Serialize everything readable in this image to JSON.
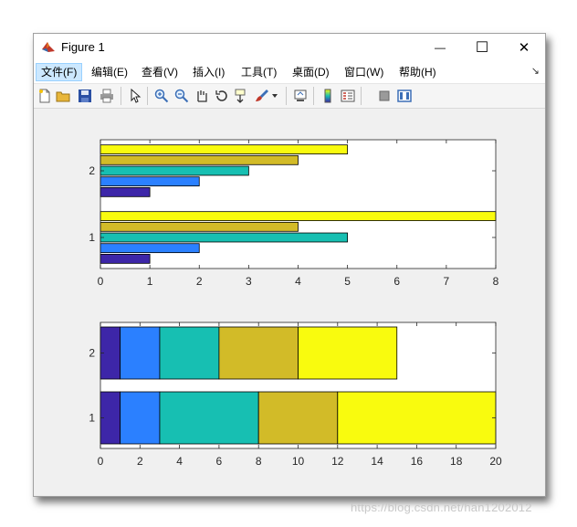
{
  "window": {
    "title": "Figure 1",
    "minimize_glyph": "—",
    "maximize_glyph": "☐",
    "close_glyph": "✕"
  },
  "menu": {
    "items": [
      {
        "label": "文件(F)",
        "active": true
      },
      {
        "label": "编辑(E)"
      },
      {
        "label": "查看(V)"
      },
      {
        "label": "插入(I)"
      },
      {
        "label": "工具(T)"
      },
      {
        "label": "桌面(D)"
      },
      {
        "label": "窗口(W)"
      },
      {
        "label": "帮助(H)"
      }
    ],
    "overflow_glyph": "↘"
  },
  "toolbar": {
    "icons": [
      "new-figure-icon",
      "open-file-icon",
      "save-icon",
      "print-icon",
      "edit-plot-arrow-icon",
      "zoom-in-icon",
      "zoom-out-icon",
      "pan-hand-icon",
      "rotate-3d-icon",
      "data-cursor-icon",
      "brush-icon",
      "brush-dropdown-icon",
      "link-plot-icon",
      "insert-colorbar-icon",
      "insert-legend-icon",
      "hide-plot-tools-icon",
      "show-plot-tools-icon"
    ]
  },
  "colors": {
    "series": [
      "#3d26a8",
      "#2b80ff",
      "#17bfb2",
      "#d2bb28",
      "#f9fb0e"
    ],
    "window_bg": "#f0f0f0",
    "axes_bg": "#ffffff"
  },
  "watermark": "https://blog.csdn.net/han1202012",
  "chart_data": [
    {
      "type": "bar",
      "orientation": "horizontal",
      "mode": "grouped",
      "categories": [
        "1",
        "2"
      ],
      "series": [
        {
          "values": [
            1,
            1
          ]
        },
        {
          "values": [
            2,
            2
          ]
        },
        {
          "values": [
            5,
            3
          ]
        },
        {
          "values": [
            4,
            4
          ]
        },
        {
          "values": [
            8,
            5
          ]
        }
      ],
      "xlim": [
        0,
        8
      ],
      "xticks": [
        0,
        1,
        2,
        3,
        4,
        5,
        6,
        7,
        8
      ],
      "grid": false,
      "legend": false
    },
    {
      "type": "bar",
      "orientation": "horizontal",
      "mode": "stacked",
      "categories": [
        "1",
        "2"
      ],
      "series": [
        {
          "values": [
            1,
            1
          ]
        },
        {
          "values": [
            2,
            2
          ]
        },
        {
          "values": [
            5,
            3
          ]
        },
        {
          "values": [
            4,
            4
          ]
        },
        {
          "values": [
            8,
            5
          ]
        }
      ],
      "xlim": [
        0,
        20
      ],
      "xticks": [
        0,
        2,
        4,
        6,
        8,
        10,
        12,
        14,
        16,
        18,
        20
      ],
      "grid": false,
      "legend": false
    }
  ]
}
